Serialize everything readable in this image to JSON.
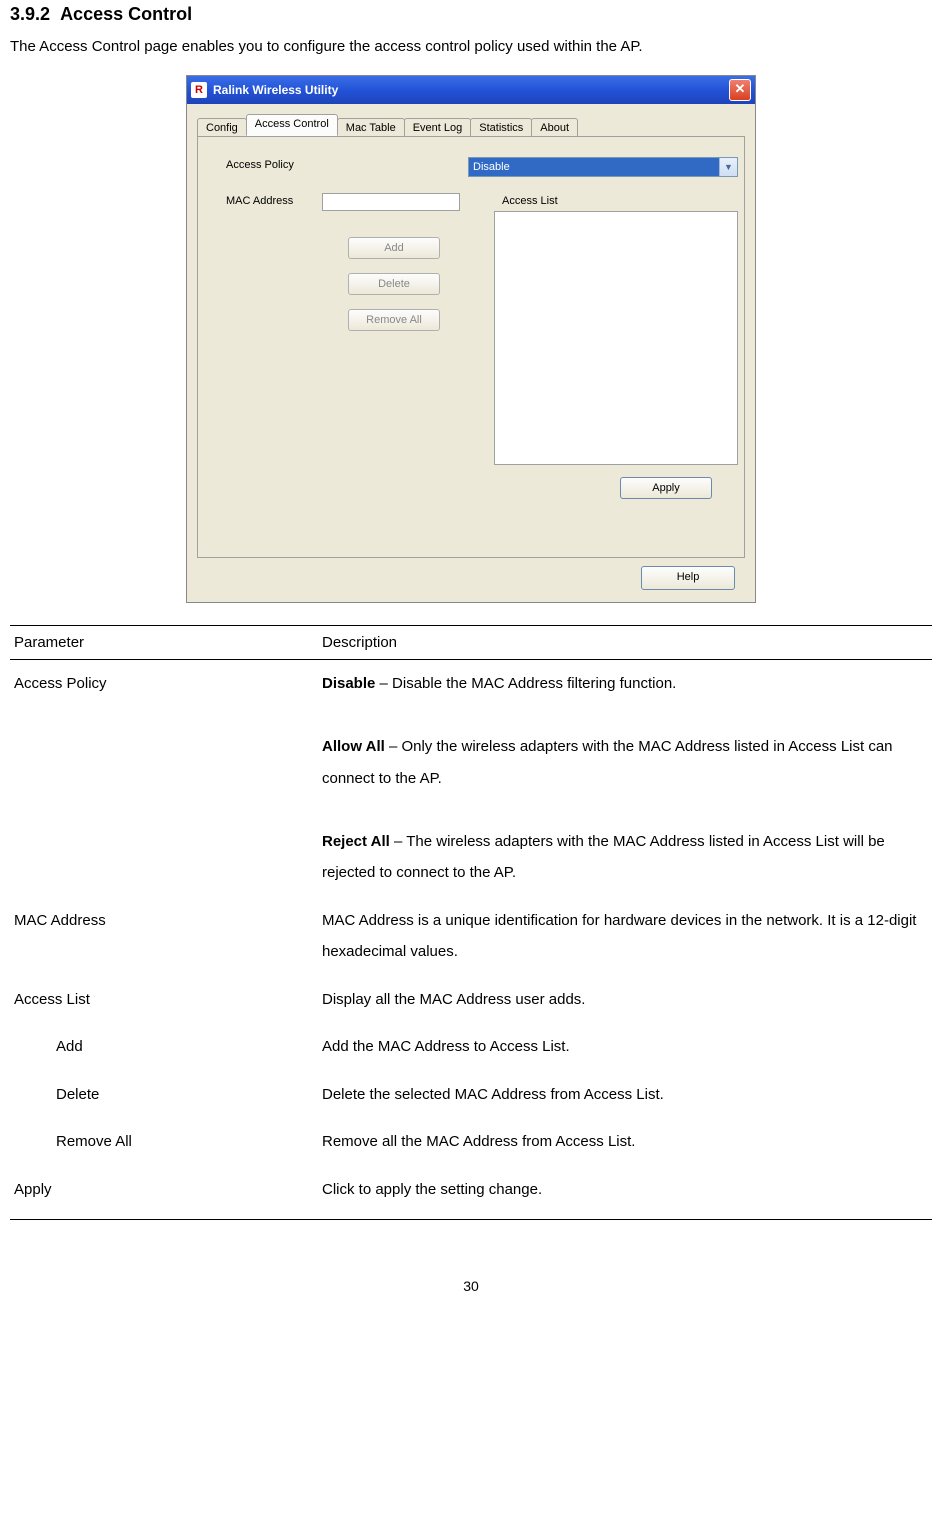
{
  "section": {
    "number": "3.9.2",
    "title": "Access Control"
  },
  "intro": "The Access Control page enables you to configure the access control policy used within the AP.",
  "app": {
    "title": "Ralink Wireless Utility",
    "tabs": [
      "Config",
      "Access Control",
      "Mac Table",
      "Event Log",
      "Statistics",
      "About"
    ],
    "labels": {
      "access_policy": "Access Policy",
      "mac_address": "MAC Address",
      "access_list": "Access List"
    },
    "dropdown_value": "Disable",
    "buttons": {
      "add": "Add",
      "delete": "Delete",
      "remove_all": "Remove All",
      "apply": "Apply",
      "help": "Help"
    }
  },
  "table": {
    "headers": {
      "param": "Parameter",
      "desc": "Description"
    },
    "rows": {
      "access_policy": {
        "param": "Access Policy",
        "disable_label": "Disable",
        "disable_text": " – Disable the MAC Address filtering function.",
        "allow_label": "Allow All",
        "allow_text": " – Only the wireless adapters with the MAC Address listed in Access List can connect to the AP.",
        "reject_label": "Reject All",
        "reject_text": " – The wireless adapters with the MAC Address listed in Access List will be rejected to connect to the AP."
      },
      "mac_address": {
        "param": "MAC Address",
        "desc": "MAC Address is a unique identification for hardware devices in the network. It is a 12-digit hexadecimal values."
      },
      "access_list": {
        "param": "Access List",
        "desc": "Display all the MAC Address user adds."
      },
      "add": {
        "param": "Add",
        "desc": "Add the MAC Address to Access List."
      },
      "delete": {
        "param": "Delete",
        "desc": "Delete the selected MAC Address from Access List."
      },
      "remove_all": {
        "param": "Remove All",
        "desc": "Remove all the MAC Address from Access List."
      },
      "apply": {
        "param": "Apply",
        "desc": "Click to apply the setting change."
      }
    }
  },
  "page_number": "30"
}
